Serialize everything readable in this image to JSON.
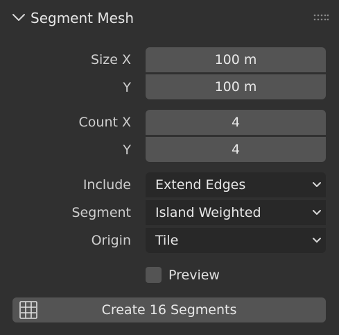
{
  "panel": {
    "title": "Segment Mesh",
    "collapse_icon": "chevron-down-icon",
    "drag_icon": "grip-dots-icon"
  },
  "size": {
    "x_label": "Size X",
    "y_label": "Y",
    "x_value": "100 m",
    "y_value": "100 m"
  },
  "count": {
    "x_label": "Count X",
    "y_label": "Y",
    "x_value": "4",
    "y_value": "4"
  },
  "include": {
    "label": "Include",
    "value": "Extend Edges"
  },
  "segment": {
    "label": "Segment",
    "value": "Island Weighted"
  },
  "origin": {
    "label": "Origin",
    "value": "Tile"
  },
  "preview": {
    "label": "Preview",
    "checked": false
  },
  "create_button": {
    "label": "Create 16 Segments",
    "icon": "grid-icon"
  },
  "colors": {
    "background": "#303030",
    "field": "#545454",
    "dropdown": "#282828",
    "text": "#e8e8e8"
  }
}
